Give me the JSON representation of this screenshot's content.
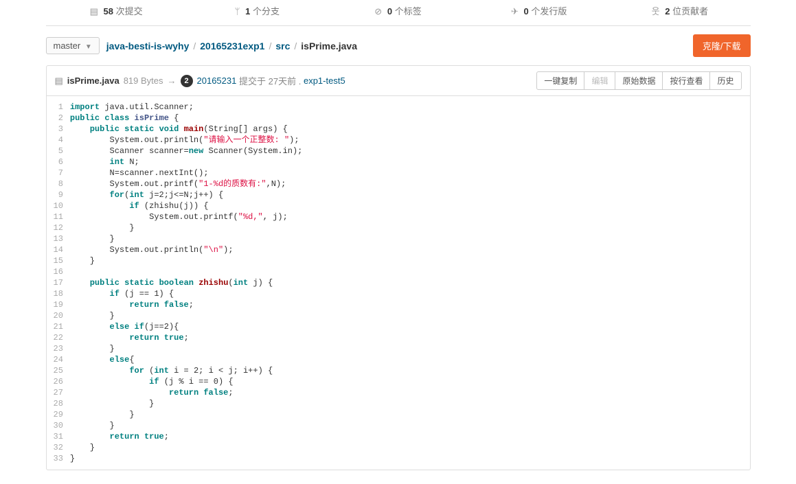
{
  "stats": {
    "commits_count": "58",
    "commits_label": "次提交",
    "branches_count": "1",
    "branches_label": "个分支",
    "tags_count": "0",
    "tags_label": "个标签",
    "releases_count": "0",
    "releases_label": "个发行版",
    "contributors_count": "2",
    "contributors_label": "位贡献者"
  },
  "branch": "master",
  "breadcrumb": {
    "root": "java-besti-is-wyhy",
    "dir": "20165231exp1",
    "sub": "src",
    "file": "isPrime.java"
  },
  "clone": "克隆/下载",
  "file": {
    "name": "isPrime.java",
    "size": "819 Bytes",
    "badge": "2",
    "author": "20165231",
    "commit_prefix": "提交于",
    "time": "27天前",
    "dot": ".",
    "msg": "exp1-test5"
  },
  "actions": {
    "copy": "一键复制",
    "edit": "编辑",
    "raw": "原始数据",
    "blame": "按行查看",
    "history": "历史"
  },
  "code": [
    {
      "n": 1,
      "t": [
        {
          "c": "kw",
          "v": "import"
        },
        {
          "c": "pl",
          "v": " java.util.Scanner;"
        }
      ]
    },
    {
      "n": 2,
      "t": [
        {
          "c": "kw",
          "v": "public"
        },
        {
          "c": "pl",
          "v": " "
        },
        {
          "c": "kw",
          "v": "class"
        },
        {
          "c": "pl",
          "v": " "
        },
        {
          "c": "tp",
          "v": "isPrime"
        },
        {
          "c": "pl",
          "v": " {"
        }
      ]
    },
    {
      "n": 3,
      "t": [
        {
          "c": "pl",
          "v": "    "
        },
        {
          "c": "kw",
          "v": "public"
        },
        {
          "c": "pl",
          "v": " "
        },
        {
          "c": "kw",
          "v": "static"
        },
        {
          "c": "pl",
          "v": " "
        },
        {
          "c": "kw",
          "v": "void"
        },
        {
          "c": "pl",
          "v": " "
        },
        {
          "c": "fn",
          "v": "main"
        },
        {
          "c": "pl",
          "v": "(String[] args) {"
        }
      ]
    },
    {
      "n": 4,
      "t": [
        {
          "c": "pl",
          "v": "        System.out.println("
        },
        {
          "c": "st",
          "v": "\"请输入一个正整数: \""
        },
        {
          "c": "pl",
          "v": ");"
        }
      ]
    },
    {
      "n": 5,
      "t": [
        {
          "c": "pl",
          "v": "        Scanner scanner="
        },
        {
          "c": "kw",
          "v": "new"
        },
        {
          "c": "pl",
          "v": " Scanner(System.in);"
        }
      ]
    },
    {
      "n": 6,
      "t": [
        {
          "c": "pl",
          "v": "        "
        },
        {
          "c": "kw",
          "v": "int"
        },
        {
          "c": "pl",
          "v": " N;"
        }
      ]
    },
    {
      "n": 7,
      "t": [
        {
          "c": "pl",
          "v": "        N=scanner.nextInt();"
        }
      ]
    },
    {
      "n": 8,
      "t": [
        {
          "c": "pl",
          "v": "        System.out.printf("
        },
        {
          "c": "st",
          "v": "\"1-%d的质数有:\""
        },
        {
          "c": "pl",
          "v": ",N);"
        }
      ]
    },
    {
      "n": 9,
      "t": [
        {
          "c": "pl",
          "v": "        "
        },
        {
          "c": "kw",
          "v": "for"
        },
        {
          "c": "pl",
          "v": "("
        },
        {
          "c": "kw",
          "v": "int"
        },
        {
          "c": "pl",
          "v": " j=2;j<=N;j++) {"
        }
      ]
    },
    {
      "n": 10,
      "t": [
        {
          "c": "pl",
          "v": "            "
        },
        {
          "c": "kw",
          "v": "if"
        },
        {
          "c": "pl",
          "v": " (zhishu(j)) {"
        }
      ]
    },
    {
      "n": 11,
      "t": [
        {
          "c": "pl",
          "v": "                System.out.printf("
        },
        {
          "c": "st",
          "v": "\"%d,\""
        },
        {
          "c": "pl",
          "v": ", j);"
        }
      ]
    },
    {
      "n": 12,
      "t": [
        {
          "c": "pl",
          "v": "            }"
        }
      ]
    },
    {
      "n": 13,
      "t": [
        {
          "c": "pl",
          "v": "        }"
        }
      ]
    },
    {
      "n": 14,
      "t": [
        {
          "c": "pl",
          "v": "        System.out.println("
        },
        {
          "c": "st",
          "v": "\"\\n\""
        },
        {
          "c": "pl",
          "v": ");"
        }
      ]
    },
    {
      "n": 15,
      "t": [
        {
          "c": "pl",
          "v": "    }"
        }
      ]
    },
    {
      "n": 16,
      "t": [
        {
          "c": "pl",
          "v": ""
        }
      ]
    },
    {
      "n": 17,
      "t": [
        {
          "c": "pl",
          "v": "    "
        },
        {
          "c": "kw",
          "v": "public"
        },
        {
          "c": "pl",
          "v": " "
        },
        {
          "c": "kw",
          "v": "static"
        },
        {
          "c": "pl",
          "v": " "
        },
        {
          "c": "kw",
          "v": "boolean"
        },
        {
          "c": "pl",
          "v": " "
        },
        {
          "c": "fn",
          "v": "zhishu"
        },
        {
          "c": "pl",
          "v": "("
        },
        {
          "c": "kw",
          "v": "int"
        },
        {
          "c": "pl",
          "v": " j) {"
        }
      ]
    },
    {
      "n": 18,
      "t": [
        {
          "c": "pl",
          "v": "        "
        },
        {
          "c": "kw",
          "v": "if"
        },
        {
          "c": "pl",
          "v": " (j == 1) {"
        }
      ]
    },
    {
      "n": 19,
      "t": [
        {
          "c": "pl",
          "v": "            "
        },
        {
          "c": "kw",
          "v": "return"
        },
        {
          "c": "pl",
          "v": " "
        },
        {
          "c": "kw",
          "v": "false"
        },
        {
          "c": "pl",
          "v": ";"
        }
      ]
    },
    {
      "n": 20,
      "t": [
        {
          "c": "pl",
          "v": "        }"
        }
      ]
    },
    {
      "n": 21,
      "t": [
        {
          "c": "pl",
          "v": "        "
        },
        {
          "c": "kw",
          "v": "else"
        },
        {
          "c": "pl",
          "v": " "
        },
        {
          "c": "kw",
          "v": "if"
        },
        {
          "c": "pl",
          "v": "(j==2){"
        }
      ]
    },
    {
      "n": 22,
      "t": [
        {
          "c": "pl",
          "v": "            "
        },
        {
          "c": "kw",
          "v": "return"
        },
        {
          "c": "pl",
          "v": " "
        },
        {
          "c": "kw",
          "v": "true"
        },
        {
          "c": "pl",
          "v": ";"
        }
      ]
    },
    {
      "n": 23,
      "t": [
        {
          "c": "pl",
          "v": "        }"
        }
      ]
    },
    {
      "n": 24,
      "t": [
        {
          "c": "pl",
          "v": "        "
        },
        {
          "c": "kw",
          "v": "else"
        },
        {
          "c": "pl",
          "v": "{"
        }
      ]
    },
    {
      "n": 25,
      "t": [
        {
          "c": "pl",
          "v": "            "
        },
        {
          "c": "kw",
          "v": "for"
        },
        {
          "c": "pl",
          "v": " ("
        },
        {
          "c": "kw",
          "v": "int"
        },
        {
          "c": "pl",
          "v": " i = 2; i < j; i++) {"
        }
      ]
    },
    {
      "n": 26,
      "t": [
        {
          "c": "pl",
          "v": "                "
        },
        {
          "c": "kw",
          "v": "if"
        },
        {
          "c": "pl",
          "v": " (j % i == 0) {"
        }
      ]
    },
    {
      "n": 27,
      "t": [
        {
          "c": "pl",
          "v": "                    "
        },
        {
          "c": "kw",
          "v": "return"
        },
        {
          "c": "pl",
          "v": " "
        },
        {
          "c": "kw",
          "v": "false"
        },
        {
          "c": "pl",
          "v": ";"
        }
      ]
    },
    {
      "n": 28,
      "t": [
        {
          "c": "pl",
          "v": "                }"
        }
      ]
    },
    {
      "n": 29,
      "t": [
        {
          "c": "pl",
          "v": "            }"
        }
      ]
    },
    {
      "n": 30,
      "t": [
        {
          "c": "pl",
          "v": "        }"
        }
      ]
    },
    {
      "n": 31,
      "t": [
        {
          "c": "pl",
          "v": "        "
        },
        {
          "c": "kw",
          "v": "return"
        },
        {
          "c": "pl",
          "v": " "
        },
        {
          "c": "kw",
          "v": "true"
        },
        {
          "c": "pl",
          "v": ";"
        }
      ]
    },
    {
      "n": 32,
      "t": [
        {
          "c": "pl",
          "v": "    }"
        }
      ]
    },
    {
      "n": 33,
      "t": [
        {
          "c": "pl",
          "v": "}"
        }
      ]
    }
  ]
}
